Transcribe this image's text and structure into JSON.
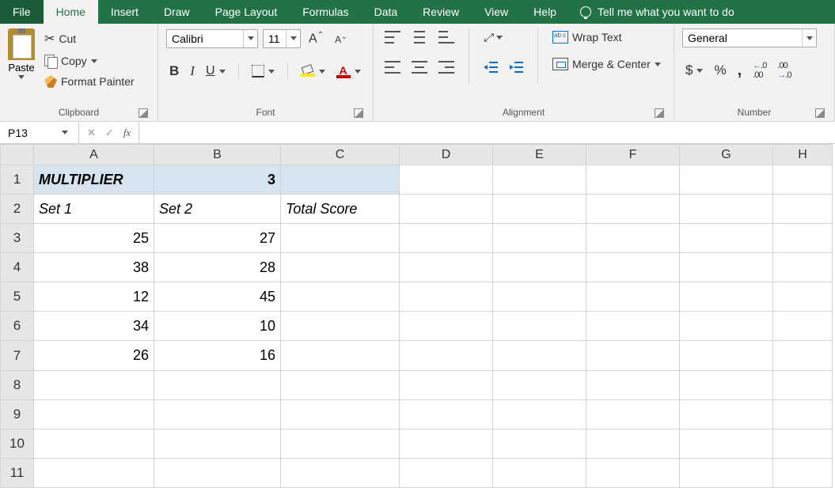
{
  "tabs": {
    "file": "File",
    "home": "Home",
    "insert": "Insert",
    "draw": "Draw",
    "page_layout": "Page Layout",
    "formulas": "Formulas",
    "data": "Data",
    "review": "Review",
    "view": "View",
    "help": "Help",
    "tellme": "Tell me what you want to do"
  },
  "ribbon": {
    "clipboard": {
      "paste": "Paste",
      "cut": "Cut",
      "copy": "Copy",
      "format_painter": "Format Painter",
      "label": "Clipboard"
    },
    "font": {
      "name": "Calibri",
      "size": "11",
      "grow_A": "A",
      "shrink_A": "A",
      "bold": "B",
      "italic": "I",
      "underline": "U",
      "color_A": "A",
      "label": "Font"
    },
    "alignment": {
      "orient": "ab",
      "wrap": "Wrap Text",
      "wrap_glyph": "ab c",
      "merge": "Merge & Center",
      "label": "Alignment"
    },
    "number": {
      "format": "General",
      "dollar": "$",
      "percent": "%",
      "comma": ",",
      "inc_dec": ".0 .00",
      "dec_dec": ".00 .0",
      "label": "Number"
    }
  },
  "fbar": {
    "name": "P13",
    "cancel": "✕",
    "enter": "✓",
    "fx": "fx",
    "formula": ""
  },
  "grid": {
    "cols": [
      "A",
      "B",
      "C",
      "D",
      "E",
      "F",
      "G",
      "H"
    ],
    "rows": [
      "1",
      "2",
      "3",
      "4",
      "5",
      "6",
      "7",
      "8",
      "9",
      "10",
      "11"
    ],
    "cells": {
      "A1": "MULTIPLIER",
      "B1": "3",
      "A2": "Set 1",
      "B2": "Set 2",
      "C2": "Total Score",
      "A3": "25",
      "B3": "27",
      "A4": "38",
      "B4": "28",
      "A5": "12",
      "B5": "45",
      "A6": "34",
      "B6": "10",
      "A7": "26",
      "B7": "16"
    }
  }
}
